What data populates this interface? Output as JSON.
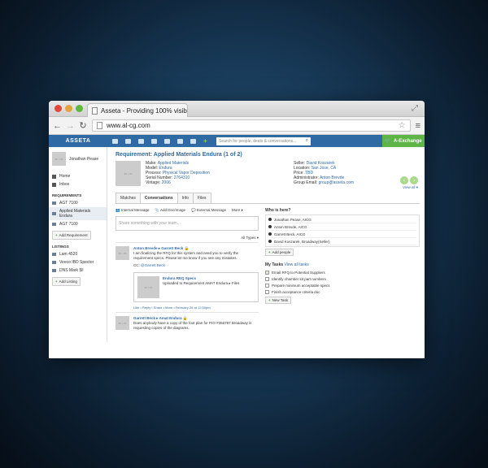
{
  "browser": {
    "tab_title": "Asseta - Providing 100% visibili",
    "url": "www.al-cg.com"
  },
  "app": {
    "brand": "ASSETA",
    "search_placeholder": "Search for people, deals & conversations...",
    "exchange_label": "A-Exchange"
  },
  "sidebar": {
    "user_name": "Jonathan Pease",
    "links": [
      {
        "label": "Home"
      },
      {
        "label": "Inbox"
      }
    ],
    "requirements_heading": "REQUIREMENTS",
    "requirements": [
      {
        "label": "AGT 7100"
      },
      {
        "label": "Applied Materials Endura"
      },
      {
        "label": "AGT 7100"
      }
    ],
    "add_requirement": "Add Requirement",
    "listings_heading": "LISTINGS",
    "listings": [
      {
        "label": "Lam 4520"
      },
      {
        "label": "Veeco IBD Spector"
      },
      {
        "label": "DNS Mark 5ll"
      }
    ],
    "add_listing": "Add Listing"
  },
  "requirement": {
    "title": "Requirement: Applied Materials Endura (1 of 2)",
    "image_placeholder": "86 x 86",
    "make_label": "Make:",
    "make": "Applied Materials",
    "model_label": "Model:",
    "model": "Endura",
    "process_label": "Process:",
    "process": "Physical Vapor Deposition",
    "serial_label": "Serial Number:",
    "serial": "2764310",
    "vintage_label": "Vintage:",
    "vintage": "2006",
    "seller_label": "Seller:",
    "seller": "David Koszarek",
    "location_label": "Location:",
    "location": "San Jose, CA",
    "price_label": "Price:",
    "price": "TBD",
    "admin_label": "Administrator:",
    "admin": "Anton Brevde",
    "group_email_label": "Group Email:",
    "group_email": "group@asseta.com",
    "view_all": "View all"
  },
  "tabs": [
    {
      "label": "Matches"
    },
    {
      "label": "Conversations"
    },
    {
      "label": "Info"
    },
    {
      "label": "Files"
    }
  ],
  "composer": {
    "actions": [
      {
        "label": "Internal Message"
      },
      {
        "label": "Add Doc/Image"
      },
      {
        "label": "External Message"
      },
      {
        "label": "More"
      }
    ],
    "placeholder": "Share something with your team...",
    "filter": "All Types"
  },
  "posts": [
    {
      "from": "Anton Brevde",
      "to": "Garrett Beck",
      "text": "I am finalizing the RFQ for this system and need you to verify the requirement specs. Please let me know if you see any mistakes.",
      "cc_label": "CC:",
      "cc": "@Garrett Beck",
      "attachment_title": "Endura REQ Specs",
      "attachment_desc": "Uploaded to Requirement AMAT Endura",
      "attachment_folder": "Files",
      "thumb": "86 x 86",
      "meta": "Like • Reply • Share • More • February 26 at 12:50pm"
    },
    {
      "from": "Garrett Beck",
      "to": "Amat Endura",
      "text": "Does anybody have a copy of the foot plan for P/O #356797 Broadway is requesting copies of the diagrams."
    }
  ],
  "who_is_here": {
    "heading": "Who is here?",
    "people": [
      {
        "name": "Jonathan Pease, AICG"
      },
      {
        "name": "Anton Brevde, AICG"
      },
      {
        "name": "Garrett Beck, AICG"
      },
      {
        "name": "David Koszarek, Broadway(Seller)"
      }
    ],
    "add_people": "Add people"
  },
  "tasks": {
    "heading": "My Tasks",
    "view_all": "View all tasks",
    "items": [
      {
        "label": "Email RFQ to Potential Suppliers"
      },
      {
        "label": "Identify chamber kit part numbers"
      },
      {
        "label": "Prepare minimum acceptable specs"
      },
      {
        "label": "Finish acceptance criteria doc"
      }
    ],
    "new_task": "New Task"
  }
}
